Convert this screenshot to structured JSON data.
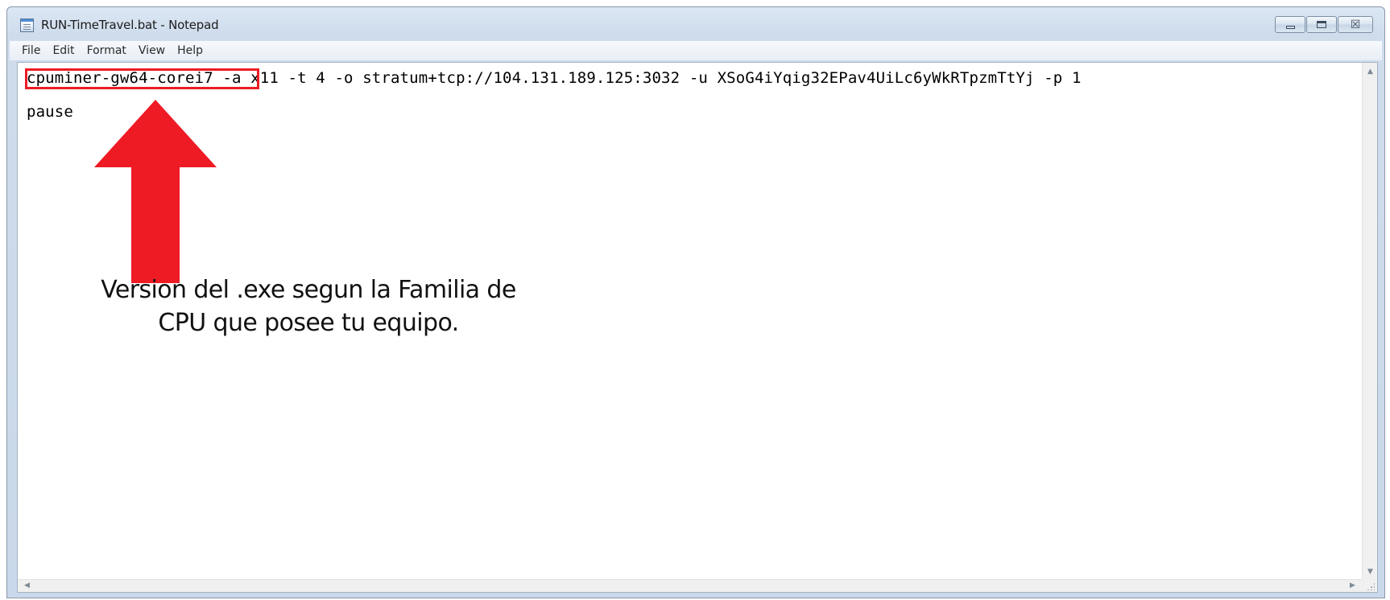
{
  "window": {
    "title": "RUN-TimeTravel.bat - Notepad",
    "icon": "notepad-icon",
    "controls": {
      "minimize_icon": "minimize-icon",
      "maximize_icon": "restore-icon",
      "close_label": "☒"
    }
  },
  "menu": {
    "items": [
      {
        "label": "File"
      },
      {
        "label": "Edit"
      },
      {
        "label": "Format"
      },
      {
        "label": "View"
      },
      {
        "label": "Help"
      }
    ]
  },
  "document": {
    "line1_exe": "cpuminer-gw64-corei7",
    "line1_args": " -a x11 -t 4 -o stratum+tcp://104.131.189.125:3032 -u XSoG4iYqig32EPav4UiLc6yWkRTpzmTtYj -p 1",
    "line2": "pause"
  },
  "annotation": {
    "line1": "Version del  .exe segun la  Familia de",
    "line2": "CPU que posee tu equipo.",
    "color": "#ee1b24"
  },
  "scrollbars": {
    "up_glyph": "▲",
    "down_glyph": "▼",
    "left_glyph": "◀",
    "right_glyph": "▶"
  }
}
